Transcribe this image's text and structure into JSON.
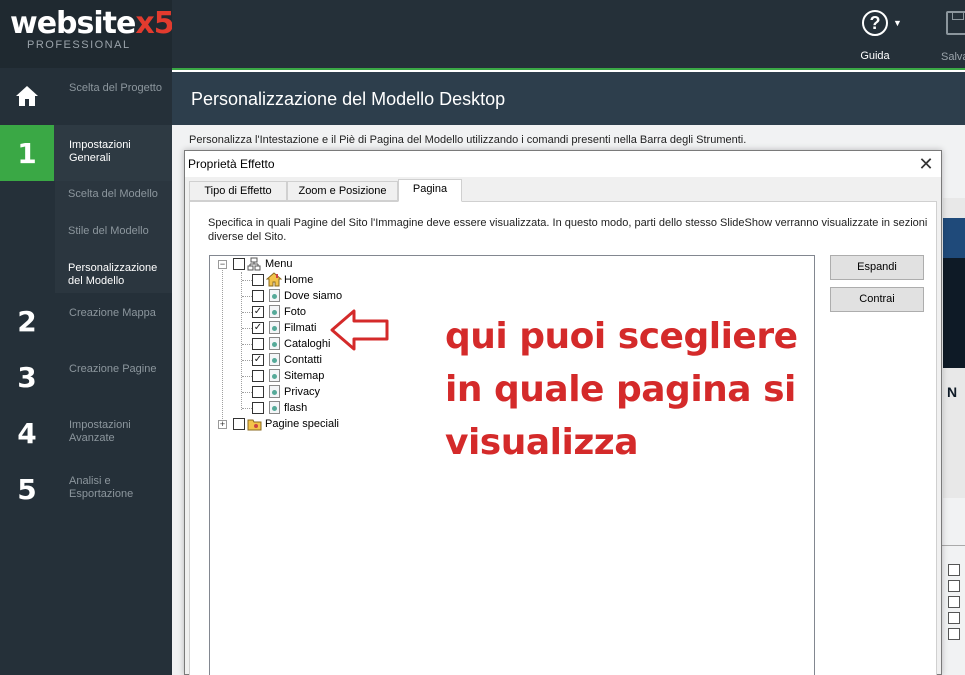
{
  "app": {
    "logo_main": "website",
    "logo_x5": "x5",
    "logo_sub": "PROFESSIONAL"
  },
  "sidebar": {
    "items": [
      {
        "num": "⌂",
        "label": "Scelta del Progetto"
      },
      {
        "num": "1",
        "label": "Impostazioni Generali"
      },
      {
        "num": "2",
        "label": "Creazione Mappa"
      },
      {
        "num": "3",
        "label": "Creazione Pagine"
      },
      {
        "num": "4",
        "label": "Impostazioni Avanzate"
      },
      {
        "num": "5",
        "label": "Analisi e Esportazione"
      }
    ],
    "subitems": [
      {
        "label": "Scelta del Modello"
      },
      {
        "label": "Stile del Modello"
      },
      {
        "label": "Personalizzazione del Modello"
      }
    ]
  },
  "toolbar": {
    "help_label": "Guida",
    "save_label": "Salva"
  },
  "page": {
    "title": "Personalizzazione del Modello Desktop",
    "description": "Personalizza l'Intestazione e il Piè di Pagina del Modello utilizzando i comandi presenti nella Barra degli Strumenti."
  },
  "dialog": {
    "title": "Proprietà Effetto",
    "close_glyph": "✕",
    "tabs": [
      {
        "label": "Tipo di Effetto"
      },
      {
        "label": "Zoom e Posizione"
      },
      {
        "label": "Pagina"
      }
    ],
    "active_tab": "Pagina",
    "description": "Specifica in quali Pagine del Sito l'Immagine deve essere visualizzata. In questo modo, parti dello stesso SlideShow verranno visualizzate in sezioni diverse del Sito.",
    "expand_label": "Espandi",
    "collapse_label": "Contrai",
    "tree": {
      "root": {
        "label": "Menu",
        "checked": false,
        "expanded": true,
        "icon": "sitemap-icon"
      },
      "pages": [
        {
          "label": "Home",
          "checked": false,
          "icon": "home-icon"
        },
        {
          "label": "Dove siamo",
          "checked": false,
          "icon": "page-icon"
        },
        {
          "label": "Foto",
          "checked": true,
          "icon": "page-icon"
        },
        {
          "label": "Filmati",
          "checked": true,
          "icon": "page-icon"
        },
        {
          "label": "Cataloghi",
          "checked": false,
          "icon": "page-icon"
        },
        {
          "label": "Contatti",
          "checked": true,
          "icon": "page-icon"
        },
        {
          "label": "Sitemap",
          "checked": false,
          "icon": "page-icon"
        },
        {
          "label": "Privacy",
          "checked": false,
          "icon": "page-icon"
        },
        {
          "label": "flash",
          "checked": false,
          "icon": "page-icon"
        }
      ],
      "special": {
        "label": "Pagine speciali",
        "checked": false,
        "expanded": false,
        "icon": "folder-icon"
      }
    }
  },
  "annotation": {
    "line1": "qui puoi scegliere",
    "line2": "in quale pagina si",
    "line3": "visualizza",
    "color": "#d42a2a"
  },
  "preview": {
    "partial_char": "N"
  },
  "colors": {
    "sidebar_bg": "#253039",
    "accent_green": "#3aa845",
    "header_bg": "#2d3e4c"
  }
}
